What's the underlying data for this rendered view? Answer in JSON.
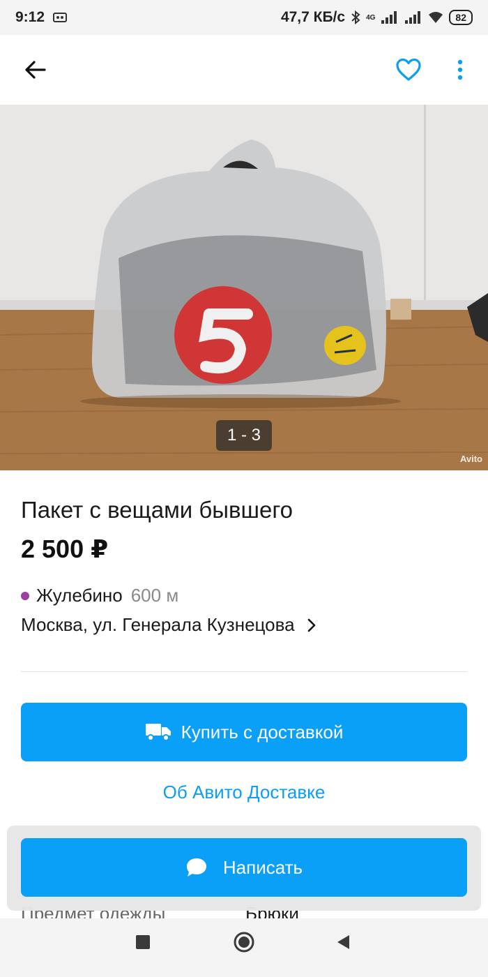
{
  "status_bar": {
    "time": "9:12",
    "speed": "47,7 КБ/с",
    "network": "4G",
    "battery": "82"
  },
  "toolbar": {
    "back_icon": "arrow-left-icon",
    "favorite_icon": "heart-outline-icon",
    "more_icon": "more-vertical-icon"
  },
  "gallery": {
    "counter": "1 - 3",
    "watermark": "Avito"
  },
  "listing": {
    "title": "Пакет с вещами бывшего",
    "price": "2 500 ₽",
    "metro_station": "Жулебино",
    "metro_distance": "600 м",
    "metro_color": "#9b3fa0",
    "address": "Москва, ул. Генерала Кузнецова"
  },
  "actions": {
    "buy_label": "Купить с доставкой",
    "buy_icon": "truck-icon",
    "delivery_link": "Об Авито Доставке",
    "write_label": "Написать",
    "write_icon": "chat-bubble-icon"
  },
  "params": [
    {
      "key": "Предмет одежды",
      "value": "Брюки"
    }
  ],
  "colors": {
    "accent": "#0aa0f7",
    "link": "#0a9ef5"
  }
}
